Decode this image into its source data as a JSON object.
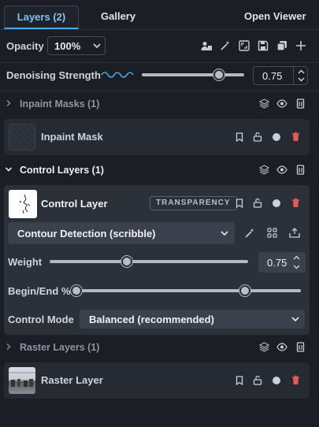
{
  "tabs": {
    "layers": "Layers (2)",
    "gallery": "Gallery",
    "open_viewer": "Open Viewer"
  },
  "toolbar": {
    "opacity_label": "Opacity",
    "opacity_value": "100%",
    "icons": [
      "users-icon",
      "magic-wand-icon",
      "fit-icon",
      "save-icon",
      "copy-icon",
      "plus-icon"
    ]
  },
  "denoise": {
    "label": "Denoising Strength",
    "value": "0.75",
    "level": 0.75
  },
  "inpaint_masks": {
    "title": "Inpaint Masks (1)",
    "layer_name": "Inpaint Mask"
  },
  "control_layers": {
    "title": "Control Layers (1)",
    "layer_name": "Control Layer",
    "badge": "TRANSPARENCY",
    "model": "Contour Detection (scribble)",
    "weight_label": "Weight",
    "weight_value": "0.75",
    "weight_level": 0.39,
    "begin_end_label": "Begin/End %",
    "begin": 0,
    "end": 0.75,
    "control_mode_label": "Control Mode",
    "control_mode_value": "Balanced (recommended)"
  },
  "raster_layers": {
    "title": "Raster Layers (1)",
    "layer_name": "Raster Layer"
  },
  "colors": {
    "accent": "#4aa7e8",
    "danger": "#e05a5a",
    "panel": "#262a32",
    "bg": "#1b1e25"
  }
}
